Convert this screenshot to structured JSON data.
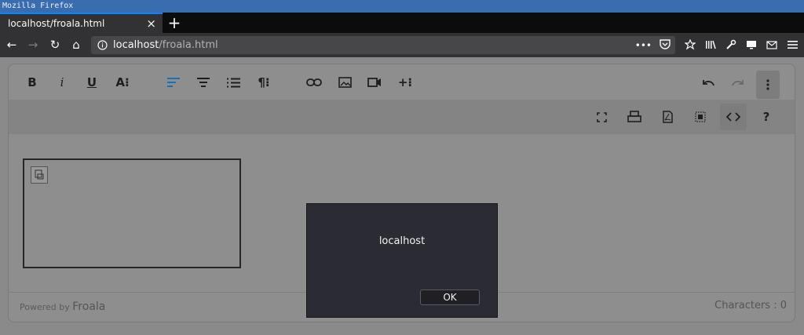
{
  "window": {
    "title": "Mozilla Firefox"
  },
  "tabs": [
    {
      "title": "localhost/froala.html",
      "close": "×"
    }
  ],
  "new_tab_label": "+",
  "nav": {
    "back": "←",
    "forward": "→",
    "reload": "↻",
    "home": "⌂",
    "url_host": "localhost",
    "url_path": "/froala.html",
    "page_actions": "•••"
  },
  "editor": {
    "toolbar": {
      "bold": "B",
      "italic": "i",
      "underline": "U",
      "font_size": "A⁝",
      "paragraph_format": "¶⁝",
      "more_text": "+⁝",
      "help": "?"
    },
    "footer": {
      "powered_prefix": "Powered by",
      "brand": "Froala",
      "characters": "Characters : 0"
    }
  },
  "dialog": {
    "message": "localhost",
    "ok_label": "OK"
  },
  "colors": {
    "accent": "#0a84ff",
    "active_tool": "#1d6fb8"
  }
}
